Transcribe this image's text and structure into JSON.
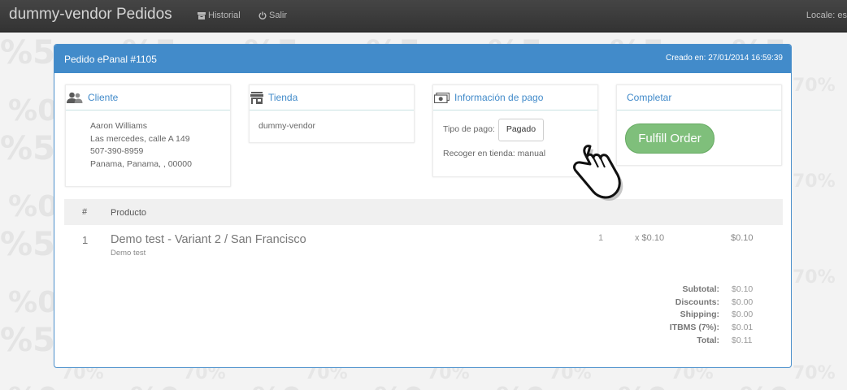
{
  "nav": {
    "brand": "dummy-vendor Pedidos",
    "historial": "Historial",
    "salir": "Salir",
    "locale": "Locale: es"
  },
  "order": {
    "title": "Pedido ePanal #1105",
    "created": "Creado en: 27/01/2014 16:59:39"
  },
  "cliente": {
    "heading": "Cliente",
    "name": "Aaron Williams",
    "address": "Las mercedes, calle A 149",
    "phone": "507-390-8959",
    "city": "Panama, Panama, , 00000"
  },
  "tienda": {
    "heading": "Tienda",
    "name": "dummy-vendor"
  },
  "pago": {
    "heading": "Información de pago",
    "tipo_label": "Tipo de pago:",
    "tipo_value": "Pagado",
    "pickup": "Recoger en tienda: manual"
  },
  "completar": {
    "heading": "Completar",
    "button": "Fulfill Order"
  },
  "table": {
    "col_num": "#",
    "col_product": "Producto",
    "rows": [
      {
        "num": "1",
        "product": "Demo test - Variant 2 / San Francisco",
        "variant": "Demo test",
        "qty": "1",
        "price": "x $0.10",
        "total": "$0.10"
      }
    ]
  },
  "totals": [
    {
      "label": "Subtotal:",
      "value": "$0.10"
    },
    {
      "label": "Discounts:",
      "value": "$0.00"
    },
    {
      "label": "Shipping:",
      "value": "$0.00"
    },
    {
      "label": "ITBMS (7%):",
      "value": "$0.01"
    },
    {
      "label": "Total:",
      "value": "$0.11"
    }
  ],
  "colors": {
    "primary": "#428bca",
    "navbar": "#3a3a3a",
    "fulfill": "#7fbf7b"
  }
}
